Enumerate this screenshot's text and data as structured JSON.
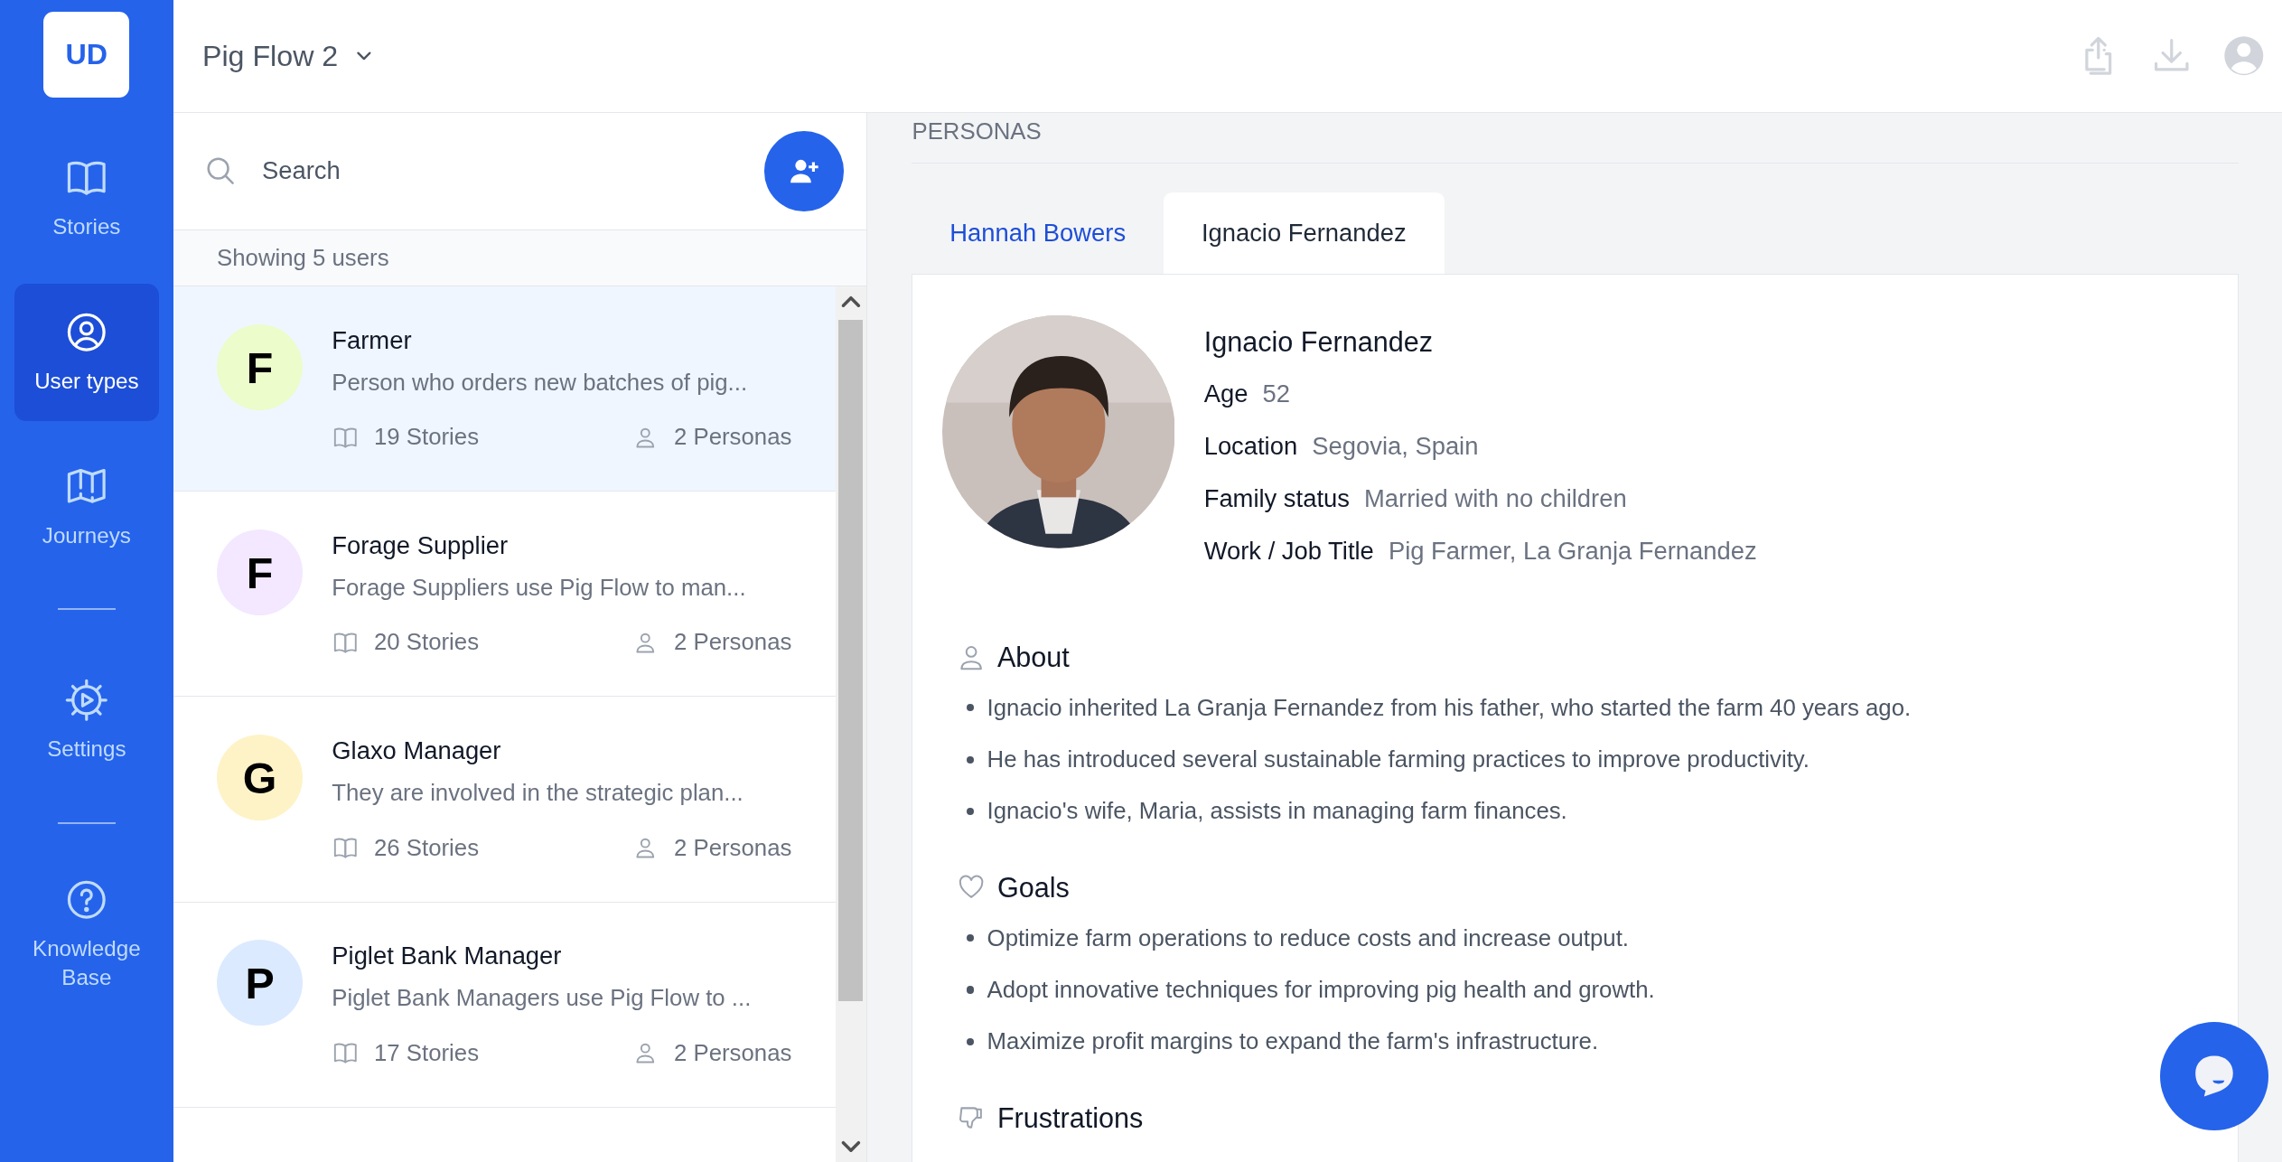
{
  "sidebar": {
    "logo": "UD",
    "groups": [
      [
        {
          "kind": "book",
          "label": "Stories",
          "selected": false
        },
        {
          "kind": "user-circle",
          "label": "User types",
          "selected": true
        },
        {
          "kind": "map",
          "label": "Journeys",
          "selected": false
        }
      ],
      [
        {
          "kind": "gear",
          "label": "Settings",
          "selected": false
        }
      ],
      [
        {
          "kind": "help",
          "label": "Knowledge Base",
          "selected": false
        }
      ]
    ]
  },
  "header": {
    "project": "Pig Flow 2"
  },
  "user_list": {
    "search": {
      "placeholder": "Search"
    },
    "count": "Showing 5 users",
    "users": [
      {
        "initial": "F",
        "color": "#ecfccb",
        "name": "Farmer",
        "description": "Person who orders new batches of pig...",
        "stories": "19 Stories",
        "personas": "2 Personas",
        "selected": true
      },
      {
        "initial": "F",
        "color": "#f3e8ff",
        "name": "Forage Supplier",
        "description": "Forage Suppliers use Pig Flow to man...",
        "stories": "20 Stories",
        "personas": "2 Personas",
        "selected": false
      },
      {
        "initial": "G",
        "color": "#fef3c7",
        "name": "Glaxo Manager",
        "description": "They are involved in the strategic plan...",
        "stories": "26 Stories",
        "personas": "2 Personas",
        "selected": false
      },
      {
        "initial": "P",
        "color": "#dbeafe",
        "name": "Piglet Bank Manager",
        "description": "Piglet Bank Managers use Pig Flow to ...",
        "stories": "17 Stories",
        "personas": "2 Personas",
        "selected": false
      }
    ]
  },
  "personas": {
    "heading": "PERSONAS",
    "tabs": [
      {
        "label": "Hannah Bowers",
        "selected": false
      },
      {
        "label": "Ignacio Fernandez",
        "selected": true
      }
    ],
    "profile": {
      "name": "Ignacio Fernandez",
      "fields": [
        {
          "label": "Age",
          "value": "52"
        },
        {
          "label": "Location",
          "value": "Segovia, Spain"
        },
        {
          "label": "Family status",
          "value": "Married with no children"
        },
        {
          "label": "Work / Job Title",
          "value": "Pig Farmer, La Granja Fernandez"
        }
      ]
    },
    "sections": [
      {
        "kind": "person",
        "title": "About",
        "items": [
          "Ignacio inherited La Granja Fernandez from his father, who started the farm 40 years ago.",
          "He has introduced several sustainable farming practices to improve productivity.",
          "Ignacio's wife, Maria, assists in managing farm finances."
        ]
      },
      {
        "kind": "heart",
        "title": "Goals",
        "items": [
          "Optimize farm operations to reduce costs and increase output.",
          "Adopt innovative techniques for improving pig health and growth.",
          "Maximize profit margins to expand the farm's infrastructure."
        ]
      },
      {
        "kind": "thumbs-down",
        "title": "Frustrations"
      }
    ]
  }
}
